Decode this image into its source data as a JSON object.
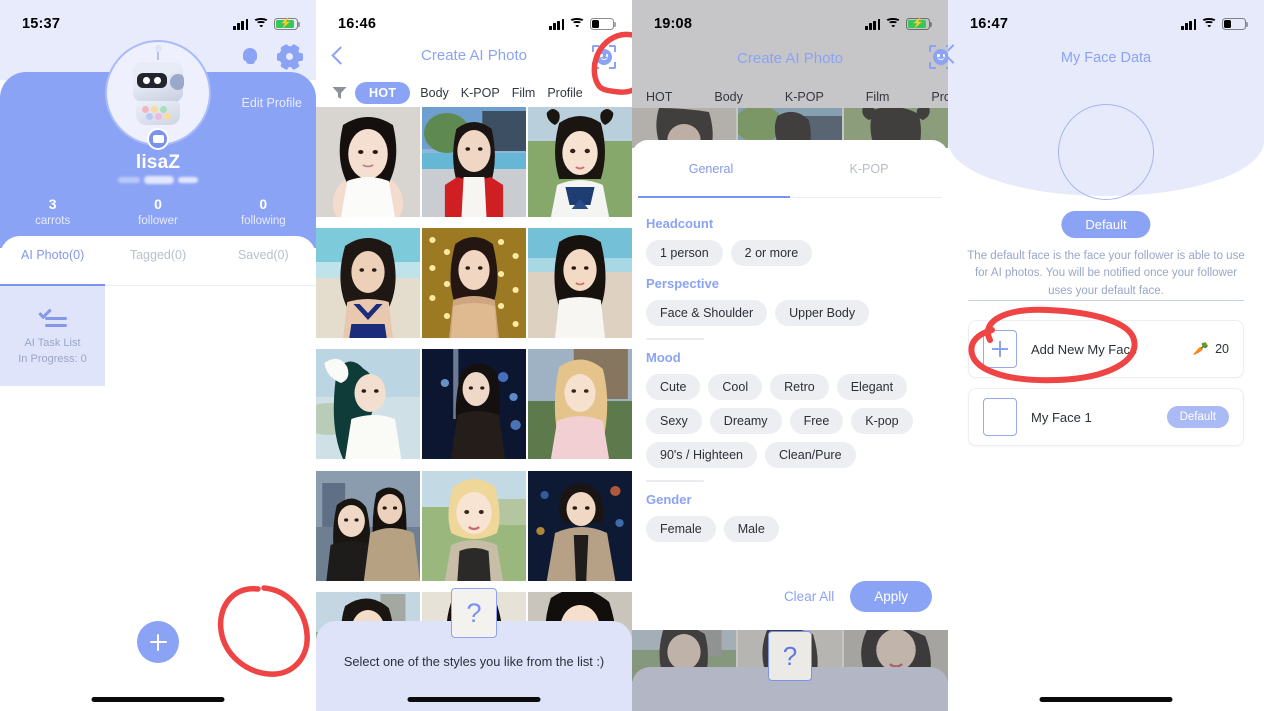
{
  "panel1": {
    "status": {
      "time": "15:37",
      "battery_charging": true
    },
    "icons": {
      "bell": "bell-icon",
      "gear": "gear-icon"
    },
    "edit_profile": "Edit Profile",
    "username": "lisaZ",
    "stats": [
      {
        "value": "3",
        "label": "carrots"
      },
      {
        "value": "0",
        "label": "follower"
      },
      {
        "value": "0",
        "label": "following"
      }
    ],
    "tabs": [
      {
        "label": "AI Photo(0)",
        "active": true
      },
      {
        "label": "Tagged(0)",
        "active": false
      },
      {
        "label": "Saved(0)",
        "active": false
      }
    ],
    "task_card": {
      "title": "AI Task List",
      "subtitle": "In Progress: 0",
      "icon": "checklist-icon"
    },
    "fab": {
      "icon": "plus-icon"
    }
  },
  "panel2": {
    "status": {
      "time": "16:46",
      "battery_charging": false
    },
    "nav": {
      "back": "back-chevron-icon",
      "title": "Create AI Photo",
      "face_scan": "face-scan-icon"
    },
    "filter_icon": "funnel-icon",
    "categories": [
      "HOT",
      "Body",
      "K-POP",
      "Film",
      "Profile"
    ],
    "active_category": "HOT",
    "hint": "Select one of the styles you like from the list :)",
    "question_card": "?"
  },
  "panel3": {
    "status": {
      "time": "19:08",
      "battery_charging": true
    },
    "nav": {
      "title": "Create AI Photo",
      "face_scan": "face-scan-icon"
    },
    "categories": [
      "HOT",
      "Body",
      "K-POP",
      "Film",
      "Pro"
    ],
    "tabs": [
      {
        "label": "General",
        "active": true
      },
      {
        "label": "K-POP",
        "active": false
      }
    ],
    "sections": [
      {
        "title": "Headcount",
        "options": [
          "1 person",
          "2 or more"
        ]
      },
      {
        "title": "Perspective",
        "options": [
          "Face & Shoulder",
          "Upper Body"
        ]
      },
      {
        "title": "Mood",
        "options": [
          "Cute",
          "Cool",
          "Retro",
          "Elegant",
          "Sexy",
          "Dreamy",
          "Free",
          "K-pop",
          "90's / Highteen",
          "Clean/Pure"
        ]
      },
      {
        "title": "Gender",
        "options": [
          "Female",
          "Male"
        ]
      }
    ],
    "actions": {
      "clear": "Clear All",
      "apply": "Apply"
    },
    "question_card": "?"
  },
  "panel4": {
    "status": {
      "time": "16:47",
      "battery_charging": false
    },
    "nav": {
      "back": "back-chevron-icon",
      "title": "My Face Data"
    },
    "default_pill": "Default",
    "description": "The default face is the face your follower is able to use for AI photos. You will be notified once your follower uses your default face.",
    "rows": [
      {
        "label": "Add New My Face",
        "cost": "20",
        "cost_icon": "carrot-icon",
        "thumb": "plus"
      },
      {
        "label": "My Face 1",
        "badge": "Default",
        "thumb": "empty"
      }
    ]
  },
  "colors": {
    "brand_blue": "#8ba3f5",
    "light_lavender": "#e6eafb",
    "annotation_red": "#ef4444",
    "chip_gray": "#eceef2"
  }
}
